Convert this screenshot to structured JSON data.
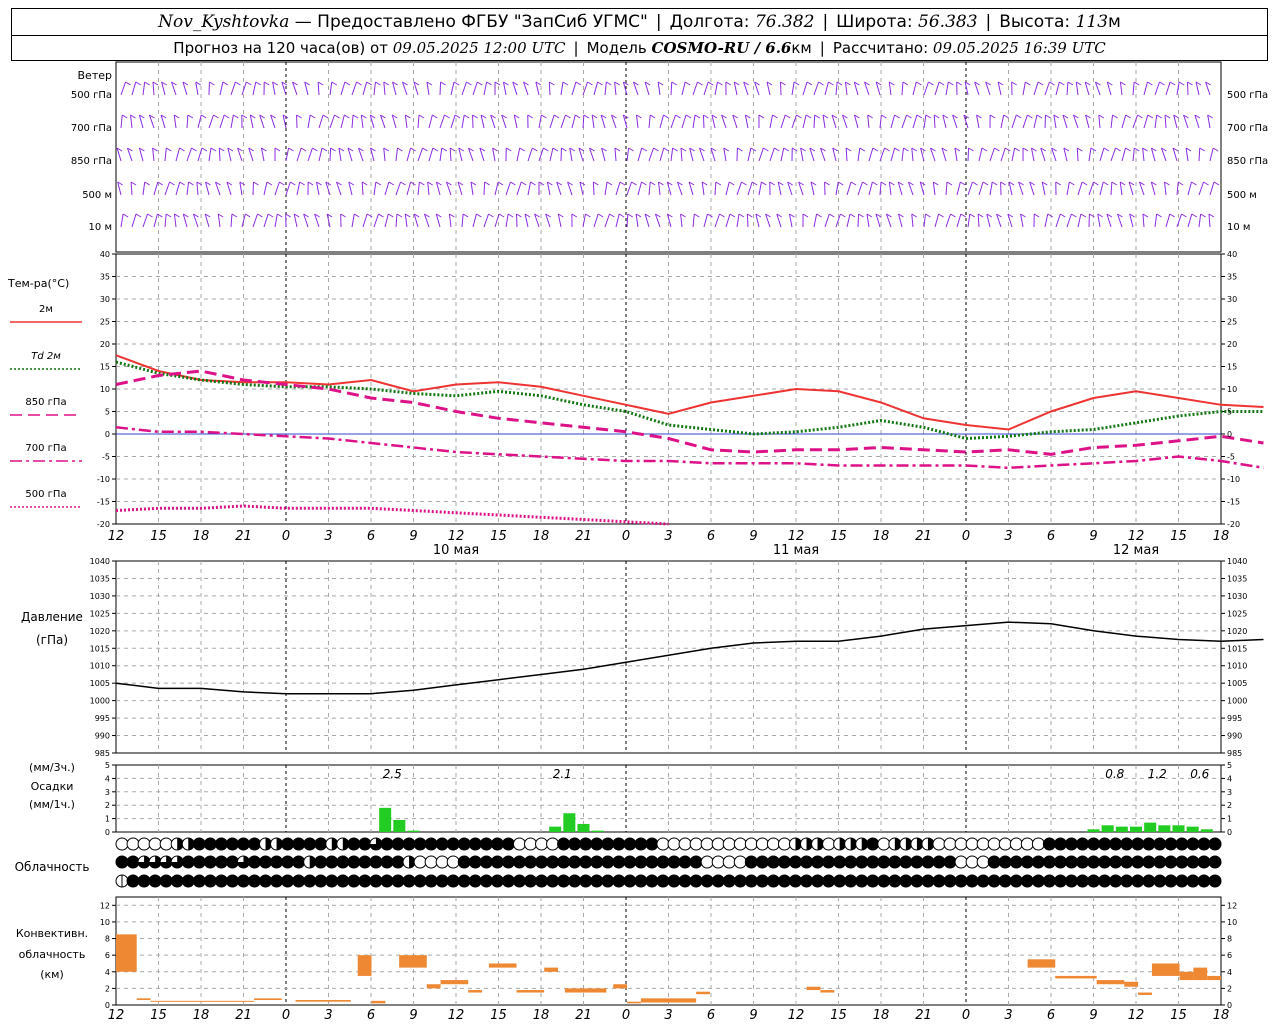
{
  "header": {
    "station": "Nov_Kyshtovka",
    "provider": "— Предоставлено ФГБУ \"ЗапСиб УГМС\"",
    "lon_label": "Долгота:",
    "lon_value": "76.382",
    "lat_label": "Широта:",
    "lat_value": "56.383",
    "alt_label": "Высота:",
    "alt_value": "113",
    "alt_unit": "м",
    "forecast_prefix": "Прогноз на 120 часа(ов) от",
    "forecast_time": "09.05.2025 12:00 UTC",
    "model_label": "Модель",
    "model_name": "COSMO-RU / 6.6",
    "model_unit": "км",
    "calc_label": "Рассчитано:",
    "calc_time": "09.05.2025 16:39 UTC"
  },
  "chart_data": [
    {
      "type": "wind-barbs",
      "title": "Ветер",
      "levels": [
        "500 гПа",
        "700 гПа",
        "850 гПа",
        "500 м",
        "10  м"
      ],
      "color": "#8b2be2"
    },
    {
      "type": "line",
      "ylabel": "Тем-ра(°С)",
      "ylim": [
        -20,
        40
      ],
      "yticks": [
        -20,
        -15,
        -10,
        -5,
        0,
        5,
        10,
        15,
        20,
        25,
        30,
        35,
        40
      ],
      "x_hours": [
        0,
        3,
        6,
        9,
        12,
        15,
        18,
        21,
        24,
        27,
        30,
        33,
        36,
        39,
        42,
        45,
        48,
        51,
        54,
        57,
        60,
        63,
        66,
        69,
        72,
        75,
        78
      ],
      "x_tick_labels": [
        "12",
        "15",
        "18",
        "21",
        "0",
        "3",
        "6",
        "9",
        "12",
        "15",
        "18",
        "21",
        "0",
        "3",
        "6",
        "9",
        "12",
        "15",
        "18",
        "21",
        "0",
        "3",
        "6",
        "9",
        "12",
        "15",
        "18"
      ],
      "date_labels": [
        {
          "hour": 24,
          "text": "10 мая"
        },
        {
          "hour": 48,
          "text": "11 мая"
        },
        {
          "hour": 72,
          "text": "12 мая"
        }
      ],
      "series": [
        {
          "name": "2м",
          "color": "#ee3333",
          "style": "solid",
          "values": [
            17.5,
            14,
            12,
            11.5,
            11.5,
            11,
            12,
            9.5,
            11,
            11.5,
            10.5,
            8.5,
            6.5,
            4.5,
            7,
            8.5,
            10,
            9.5,
            7,
            3.5,
            2,
            1,
            5,
            8,
            9.5,
            8,
            6.5,
            6
          ]
        },
        {
          "name": "Td 2м",
          "color": "#117711",
          "style": "dotted",
          "values": [
            16,
            13.5,
            12,
            11,
            10.5,
            10.5,
            10,
            9,
            8.5,
            9.5,
            8.5,
            6.5,
            5,
            2,
            1,
            0,
            0.5,
            1.5,
            3,
            1.5,
            -1,
            -0.5,
            0.5,
            1,
            2.5,
            4,
            5,
            5
          ]
        },
        {
          "name": "850 гПа",
          "color": "#dd1188",
          "style": "dash",
          "values": [
            11,
            13,
            14,
            12,
            11,
            10,
            8,
            7,
            5,
            3.5,
            2.5,
            1.5,
            0.5,
            -1,
            -3.5,
            -4,
            -3.5,
            -3.5,
            -3,
            -3.5,
            -4,
            -3.5,
            -4.5,
            -3,
            -2.5,
            -1.5,
            -0.5,
            -2
          ]
        },
        {
          "name": "700 гПа",
          "color": "#dd1188",
          "style": "dashdot",
          "values": [
            1.5,
            0.5,
            0.5,
            0,
            -0.5,
            -1,
            -2,
            -3,
            -4,
            -4.5,
            -5,
            -5.5,
            -6,
            -6,
            -6.5,
            -6.5,
            -6.5,
            -7,
            -7,
            -7,
            -7,
            -7.5,
            -7,
            -6.5,
            -6,
            -5,
            -6,
            -7.5
          ]
        },
        {
          "name": "500 гПа",
          "color": "#dd1188",
          "style": "dotted",
          "values": [
            -17,
            -16.5,
            -16.5,
            -16,
            -16.5,
            -16.5,
            -16.5,
            -17,
            -17.5,
            -18,
            -18.5,
            -19,
            -19.5,
            -20
          ]
        }
      ]
    },
    {
      "type": "line",
      "ylabel": "Давление",
      "yunit": "(гПа)",
      "ylim": [
        985,
        1040
      ],
      "yticks": [
        985,
        990,
        995,
        1000,
        1005,
        1010,
        1015,
        1020,
        1025,
        1030,
        1035,
        1040
      ],
      "series": [
        {
          "name": "Давление",
          "color": "#000000",
          "values": [
            1005,
            1003.5,
            1003.5,
            1002.5,
            1002,
            1002,
            1002,
            1003,
            1004.5,
            1006,
            1007.5,
            1009,
            1011,
            1013,
            1015,
            1016.5,
            1017,
            1017,
            1018.5,
            1020.5,
            1021.5,
            1022.5,
            1022,
            1020,
            1018.5,
            1017.5,
            1017,
            1017.5
          ]
        }
      ]
    },
    {
      "type": "bar",
      "ylabel_top": "(мм/3ч.)",
      "ylabel": "Осадки",
      "yunit": "(мм/1ч.)",
      "ylim": [
        0,
        5
      ],
      "yticks": [
        0,
        1,
        2,
        3,
        4,
        5
      ],
      "color": "#22cc22",
      "hourly": [
        [
          19,
          1.8
        ],
        [
          20,
          0.9
        ],
        [
          21,
          0.1
        ],
        [
          31,
          0.4
        ],
        [
          32,
          1.4
        ],
        [
          33,
          0.6
        ],
        [
          34,
          0.1
        ],
        [
          69,
          0.2
        ],
        [
          70,
          0.5
        ],
        [
          71,
          0.4
        ],
        [
          72,
          0.4
        ],
        [
          73,
          0.7
        ],
        [
          74,
          0.5
        ],
        [
          75,
          0.5
        ],
        [
          76,
          0.4
        ],
        [
          77,
          0.2
        ]
      ],
      "totals_3h": [
        {
          "hour": 19.5,
          "text": "2.5"
        },
        {
          "hour": 31.5,
          "text": "2.1"
        },
        {
          "hour": 70.5,
          "text": "0.8"
        },
        {
          "hour": 73.5,
          "text": "1.2"
        },
        {
          "hour": 76.5,
          "text": "0.6"
        }
      ]
    },
    {
      "type": "cloud-symbols",
      "ylabel": "Облачность",
      "rows": [
        "0000022444444224444224434444444444440000444444444000000000000222022240222200000000004444444444444444",
        "4433334444434444424444444420000444444444444444444444400004444444444444444444000444444444444444444444",
        "1444444444444444444444444444444444444444444444444444444444444444444444444444444444444444444444444444"
      ]
    },
    {
      "type": "bar",
      "ylabel": "Конвективн. облачность",
      "yunit": "(км)",
      "ylim": [
        0,
        13
      ],
      "yticks": [
        0,
        2,
        4,
        6,
        8,
        10,
        12
      ],
      "color": "#ee8833",
      "segments": [
        [
          0,
          1.5,
          4,
          8.5
        ],
        [
          1.5,
          2.5,
          0.6,
          0.8
        ],
        [
          2.5,
          10,
          0.4,
          0.5
        ],
        [
          10,
          12,
          0.6,
          0.8
        ],
        [
          13,
          17,
          0.4,
          0.6
        ],
        [
          17.5,
          18.5,
          3.5,
          6
        ],
        [
          18.5,
          19.5,
          0.2,
          0.5
        ],
        [
          20.5,
          22.5,
          4.5,
          6
        ],
        [
          22.5,
          23.5,
          2,
          2.5
        ],
        [
          23.5,
          25.5,
          2.5,
          3
        ],
        [
          25.5,
          26.5,
          1.5,
          1.8
        ],
        [
          27,
          29,
          4.5,
          5
        ],
        [
          29,
          31,
          1.5,
          1.8
        ],
        [
          31,
          32,
          4,
          4.5
        ],
        [
          32.5,
          35.5,
          1.5,
          2
        ],
        [
          36,
          37,
          2,
          2.5
        ],
        [
          37,
          38,
          0.2,
          0.4
        ],
        [
          38,
          42,
          0.3,
          0.8
        ],
        [
          42,
          43,
          1.3,
          1.6
        ],
        [
          50,
          51,
          1.8,
          2.2
        ],
        [
          51,
          52,
          1.5,
          1.8
        ],
        [
          66,
          68,
          4.5,
          5.5
        ],
        [
          68,
          71,
          3.2,
          3.5
        ],
        [
          71,
          73,
          2.5,
          3
        ],
        [
          73,
          74,
          2.2,
          2.8
        ],
        [
          74,
          75,
          1.2,
          1.5
        ],
        [
          75,
          77,
          3.5,
          5
        ],
        [
          77,
          78,
          3,
          4
        ],
        [
          78,
          79,
          3,
          4.5
        ],
        [
          79,
          80,
          3,
          3.5
        ]
      ]
    }
  ]
}
